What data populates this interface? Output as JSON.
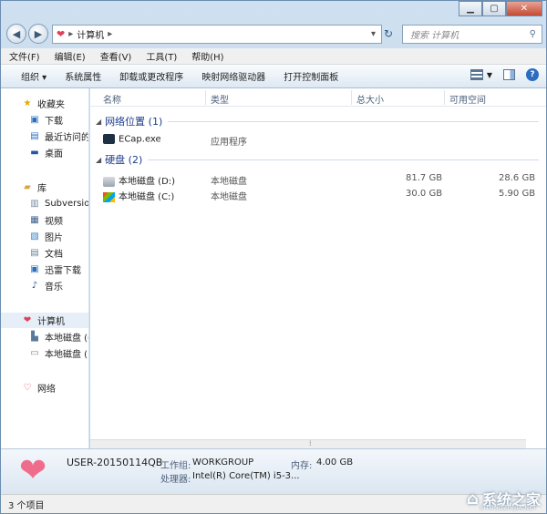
{
  "address": {
    "segment": "计算机"
  },
  "search": {
    "placeholder": "搜索 计算机"
  },
  "menu": [
    "文件(F)",
    "编辑(E)",
    "查看(V)",
    "工具(T)",
    "帮助(H)"
  ],
  "toolbar": [
    "组织 ▾",
    "系统属性",
    "卸载或更改程序",
    "映射网络驱动器",
    "打开控制面板"
  ],
  "sidebar": {
    "favorites": {
      "label": "收藏夹",
      "items": [
        "下载",
        "最近访问的",
        "桌面"
      ]
    },
    "libraries": {
      "label": "库",
      "items": [
        "Subversion",
        "视频",
        "图片",
        "文档",
        "迅雷下载",
        "音乐"
      ]
    },
    "computer": {
      "label": "计算机",
      "items": [
        "本地磁盘 (C",
        "本地磁盘 (D"
      ]
    },
    "network": {
      "label": "网络"
    }
  },
  "columns": [
    "名称",
    "类型",
    "总大小",
    "可用空间"
  ],
  "groups": [
    {
      "label": "网络位置 (1)",
      "items": [
        {
          "name": "ECap.exe",
          "type": "应用程序",
          "total": "",
          "free": ""
        }
      ]
    },
    {
      "label": "硬盘 (2)",
      "items": [
        {
          "name": "本地磁盘 (D:)",
          "type": "本地磁盘",
          "total": "81.7 GB",
          "free": "28.6 GB"
        },
        {
          "name": "本地磁盘 (C:)",
          "type": "本地磁盘",
          "total": "30.0 GB",
          "free": "5.90 GB"
        }
      ]
    }
  ],
  "details": {
    "computer_name": "USER-20150114QB",
    "workgroup_label": "工作组:",
    "workgroup": "WORKGROUP",
    "memory_label": "内存:",
    "memory": "4.00 GB",
    "processor_label": "处理器:",
    "processor": "Intel(R) Core(TM) i5-3..."
  },
  "status": "3 个项目",
  "watermark": {
    "text": "系统之家",
    "sub": "XITONGZHIJIA.NET"
  }
}
